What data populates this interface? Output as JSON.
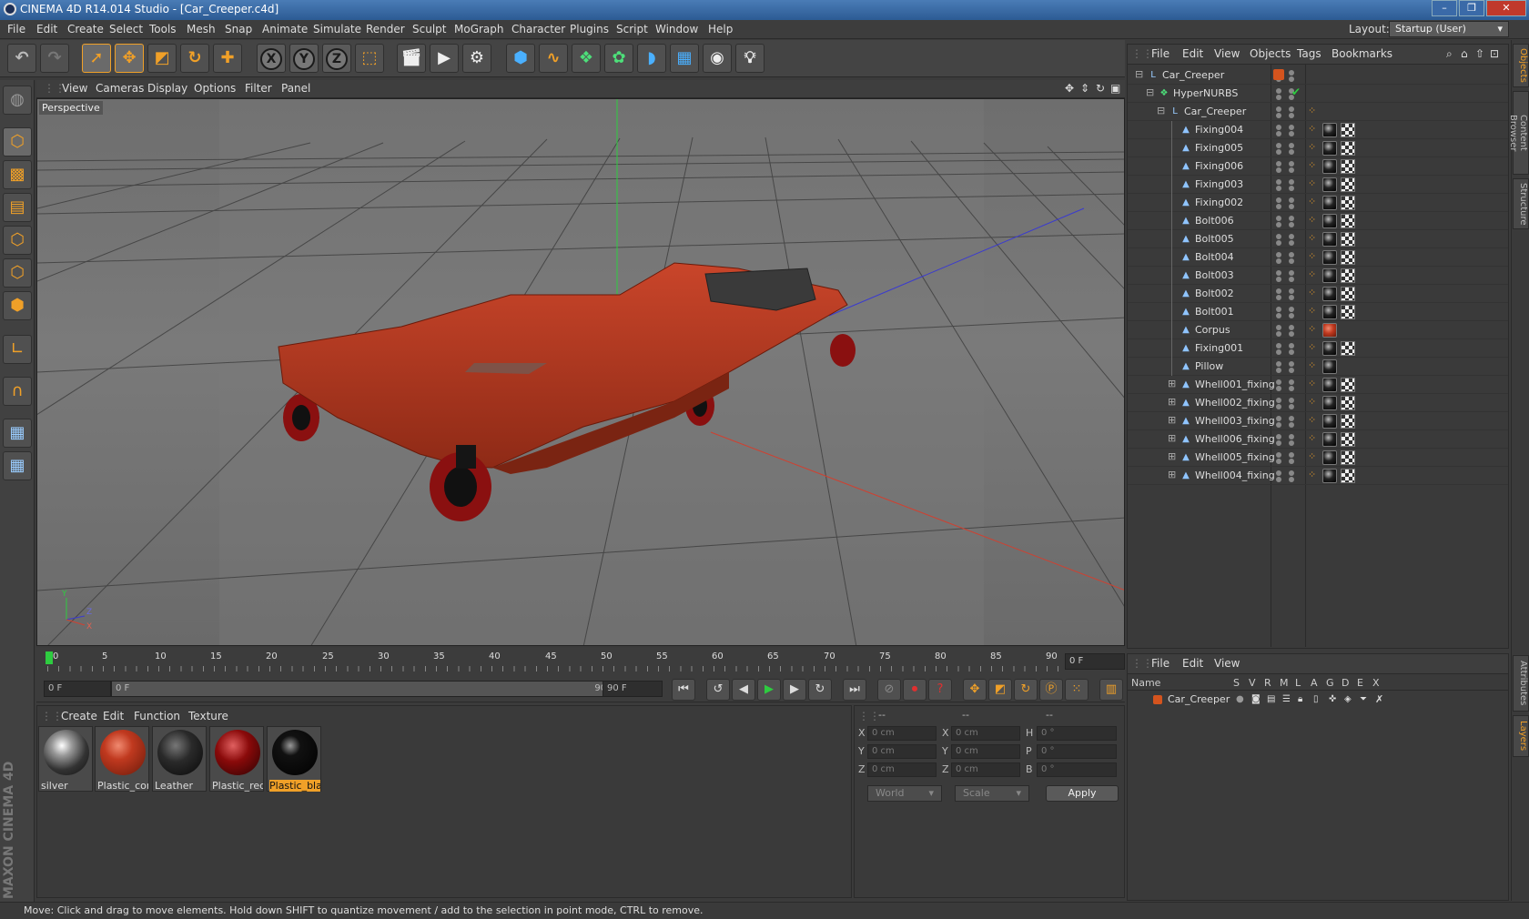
{
  "window": {
    "title": "CINEMA 4D R14.014 Studio - [Car_Creeper.c4d]",
    "controls": [
      "–",
      "❐",
      "✕"
    ]
  },
  "menubar": {
    "items": [
      "File",
      "Edit",
      "Create",
      "Select",
      "Tools",
      "Mesh",
      "Snap",
      "Animate",
      "Simulate",
      "Render",
      "Sculpt",
      "MoGraph",
      "Character",
      "Plugins",
      "Script",
      "Window",
      "Help"
    ],
    "layout_label": "Layout:",
    "layout_value": "Startup (User)"
  },
  "viewport": {
    "menu": [
      "View",
      "Cameras",
      "Display",
      "Options",
      "Filter",
      "Panel"
    ],
    "label": "Perspective",
    "axis_letters": {
      "y": "Y",
      "z": "Z",
      "x": "X"
    }
  },
  "timeline": {
    "ticks": [
      "0",
      "5",
      "10",
      "15",
      "20",
      "25",
      "30",
      "35",
      "40",
      "45",
      "50",
      "55",
      "60",
      "65",
      "70",
      "75",
      "80",
      "85",
      "90"
    ],
    "current_frame": "0 F"
  },
  "transport": {
    "start_field": "0 F",
    "range_start": "0 F",
    "range_end": "90 F",
    "end_field": "90 F"
  },
  "materials": {
    "menu": [
      "Create",
      "Edit",
      "Function",
      "Texture"
    ],
    "items": [
      {
        "name": "silver"
      },
      {
        "name": "Plastic_corp"
      },
      {
        "name": "Leather"
      },
      {
        "name": "Plastic_red"
      },
      {
        "name": "Plastic_blac"
      }
    ],
    "selected_index": 4
  },
  "coordinates": {
    "header_dashes": [
      "--",
      "--",
      "--"
    ],
    "rows": [
      {
        "l1": "X",
        "v1": "0 cm",
        "l2": "X",
        "v2": "0 cm",
        "l3": "H",
        "v3": "0 °"
      },
      {
        "l1": "Y",
        "v1": "0 cm",
        "l2": "Y",
        "v2": "0 cm",
        "l3": "P",
        "v3": "0 °"
      },
      {
        "l1": "Z",
        "v1": "0 cm",
        "l2": "Z",
        "v2": "0 cm",
        "l3": "B",
        "v3": "0 °"
      }
    ],
    "mode": "World",
    "transform": "Scale",
    "apply": "Apply"
  },
  "objects": {
    "menu": [
      "File",
      "Edit",
      "View",
      "Objects",
      "Tags",
      "Bookmarks"
    ],
    "rows": [
      {
        "name": "Car_Creeper",
        "indent": 0,
        "icon": "null-icon",
        "expand": "⊟"
      },
      {
        "name": "HyperNURBS",
        "indent": 1,
        "icon": "hypernurbs-icon",
        "expand": "⊟"
      },
      {
        "name": "Car_Creeper",
        "indent": 2,
        "icon": "null-icon",
        "expand": "⊟"
      },
      {
        "name": "Fixing004",
        "indent": 3,
        "icon": "polygon-icon",
        "expand": ""
      },
      {
        "name": "Fixing005",
        "indent": 3,
        "icon": "polygon-icon",
        "expand": ""
      },
      {
        "name": "Fixing006",
        "indent": 3,
        "icon": "polygon-icon",
        "expand": ""
      },
      {
        "name": "Fixing003",
        "indent": 3,
        "icon": "polygon-icon",
        "expand": ""
      },
      {
        "name": "Fixing002",
        "indent": 3,
        "icon": "polygon-icon",
        "expand": ""
      },
      {
        "name": "Bolt006",
        "indent": 3,
        "icon": "polygon-icon",
        "expand": ""
      },
      {
        "name": "Bolt005",
        "indent": 3,
        "icon": "polygon-icon",
        "expand": ""
      },
      {
        "name": "Bolt004",
        "indent": 3,
        "icon": "polygon-icon",
        "expand": ""
      },
      {
        "name": "Bolt003",
        "indent": 3,
        "icon": "polygon-icon",
        "expand": ""
      },
      {
        "name": "Bolt002",
        "indent": 3,
        "icon": "polygon-icon",
        "expand": ""
      },
      {
        "name": "Bolt001",
        "indent": 3,
        "icon": "polygon-icon",
        "expand": ""
      },
      {
        "name": "Corpus",
        "indent": 3,
        "icon": "polygon-icon",
        "expand": ""
      },
      {
        "name": "Fixing001",
        "indent": 3,
        "icon": "polygon-icon",
        "expand": ""
      },
      {
        "name": "Pillow",
        "indent": 3,
        "icon": "polygon-icon",
        "expand": ""
      },
      {
        "name": "Whell001_fixing",
        "indent": 3,
        "icon": "polygon-icon",
        "expand": "⊞"
      },
      {
        "name": "Whell002_fixing",
        "indent": 3,
        "icon": "polygon-icon",
        "expand": "⊞"
      },
      {
        "name": "Whell003_fixing",
        "indent": 3,
        "icon": "polygon-icon",
        "expand": "⊞"
      },
      {
        "name": "Whell006_fixing",
        "indent": 3,
        "icon": "polygon-icon",
        "expand": "⊞"
      },
      {
        "name": "Whell005_fixing",
        "indent": 3,
        "icon": "polygon-icon",
        "expand": "⊞"
      },
      {
        "name": "Whell004_fixing",
        "indent": 3,
        "icon": "polygon-icon",
        "expand": "⊞"
      }
    ]
  },
  "layers": {
    "menu": [
      "File",
      "Edit",
      "View"
    ],
    "columns": [
      "Name",
      "S",
      "V",
      "R",
      "M",
      "L",
      "A",
      "G",
      "D",
      "E",
      "X"
    ],
    "rows": [
      {
        "name": "Car_Creeper"
      }
    ]
  },
  "side_tabs": [
    "Objects",
    "Content Browser",
    "Structure",
    "Attributes",
    "Layers"
  ],
  "status": "Move: Click and drag to move elements. Hold down SHIFT to quantize movement / add to the selection in point mode, CTRL to remove.",
  "brand": "MAXON CINEMA 4D",
  "colors": {
    "accent": "#f0a028",
    "body_red": "#b8391f",
    "axis_green": "#2ecc40",
    "axis_blue": "#3a3ad0",
    "axis_red": "#d04030"
  }
}
